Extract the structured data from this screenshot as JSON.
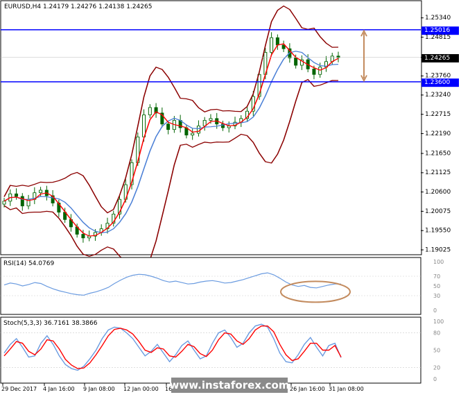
{
  "header": {
    "symbol_line": "EURUSD,H4  1.24179 1.24276 1.24138 1.24265"
  },
  "price_axis": {
    "ticks": [
      "1.25340",
      "1.24815",
      "1.24265",
      "1.23760",
      "1.23240",
      "1.22715",
      "1.22190",
      "1.21650",
      "1.21125",
      "1.20600",
      "1.20075",
      "1.19550",
      "1.19025"
    ],
    "tick_values": [
      1.2534,
      1.24815,
      1.24265,
      1.2376,
      1.2324,
      1.22715,
      1.2219,
      1.2165,
      1.21125,
      1.206,
      1.20075,
      1.1955,
      1.19025
    ],
    "ylim": [
      1.1893,
      1.2562
    ]
  },
  "levels": {
    "resistance": {
      "label": "1.25016",
      "value": 1.25016,
      "color": "#0000ff"
    },
    "support": {
      "label": "1.23600",
      "value": 1.236,
      "color": "#0000ff"
    },
    "current": {
      "label": "1.24265",
      "value": 1.24265,
      "color": "#000000"
    }
  },
  "rsi_panel": {
    "label": "RSI(14) 54.0769",
    "ticks": [
      "100",
      "70",
      "50",
      "30",
      "0"
    ],
    "tick_values": [
      100,
      70,
      50,
      30,
      0
    ]
  },
  "stoch_panel": {
    "label": "Stoch(5,3,3) 36.7161 38.3866",
    "ticks": [
      "100",
      "80",
      "50",
      "20",
      "0"
    ],
    "tick_values": [
      100,
      80,
      50,
      20,
      0
    ]
  },
  "time_axis": {
    "labels": [
      "29 Dec 2017",
      "4 Jan 16:00",
      "9 Jan 08:00",
      "12 Jan 00:00",
      "16 Jan",
      "26 Jan 16:00",
      "31 Jan 08:00"
    ]
  },
  "watermark": "www.instaforex.com",
  "colors": {
    "candle": "#006400",
    "bollinger": "#8b0000",
    "ma_fast": "#ff0000",
    "ma_slow": "#4a7fd6",
    "rsi_line": "#6a9be0",
    "stoch_main": "#6a9be0",
    "stoch_signal": "#ff0000",
    "annotation": "#c38b5e"
  },
  "chart_data": [
    {
      "type": "candlestick",
      "title": "EURUSD,H4",
      "approx_closes": [
        1.2035,
        1.2055,
        1.2048,
        1.2022,
        1.204,
        1.2058,
        1.2065,
        1.205,
        1.203,
        1.2005,
        1.1985,
        1.1965,
        1.1945,
        1.1935,
        1.194,
        1.195,
        1.196,
        1.1975,
        1.2,
        1.204,
        1.208,
        1.214,
        1.221,
        1.227,
        1.229,
        1.2275,
        1.2245,
        1.223,
        1.2255,
        1.2235,
        1.2215,
        1.222,
        1.224,
        1.2255,
        1.226,
        1.2245,
        1.2235,
        1.224,
        1.225,
        1.226,
        1.228,
        1.232,
        1.238,
        1.244,
        1.248,
        1.246,
        1.245,
        1.2425,
        1.2405,
        1.242,
        1.2395,
        1.238,
        1.24,
        1.2415,
        1.243,
        1.2426
      ]
    },
    {
      "type": "line",
      "title": "RSI(14) 54.0769",
      "ylim": [
        0,
        100
      ],
      "values": [
        52,
        56,
        54,
        50,
        53,
        57,
        55,
        49,
        44,
        40,
        37,
        34,
        32,
        31,
        35,
        38,
        42,
        47,
        55,
        62,
        68,
        72,
        74,
        73,
        70,
        66,
        61,
        58,
        60,
        57,
        54,
        55,
        58,
        60,
        61,
        59,
        56,
        57,
        60,
        63,
        67,
        71,
        75,
        77,
        73,
        66,
        58,
        52,
        49,
        51,
        47,
        46,
        49,
        52,
        54,
        54
      ]
    },
    {
      "type": "line",
      "title": "Stoch(5,3,3) 36.7161 38.3866",
      "ylim": [
        0,
        100
      ],
      "series": [
        {
          "values": [
            45,
            60,
            70,
            55,
            38,
            40,
            62,
            75,
            60,
            40,
            25,
            18,
            15,
            22,
            35,
            50,
            70,
            85,
            90,
            88,
            80,
            70,
            55,
            40,
            48,
            60,
            45,
            30,
            42,
            58,
            66,
            50,
            35,
            40,
            62,
            80,
            85,
            72,
            55,
            62,
            80,
            92,
            95,
            90,
            70,
            45,
            30,
            28,
            42,
            60,
            72,
            55,
            40,
            58,
            62,
            37
          ]
        },
        {
          "values": [
            40,
            52,
            65,
            62,
            48,
            42,
            52,
            68,
            66,
            52,
            34,
            24,
            18,
            19,
            28,
            42,
            58,
            75,
            86,
            88,
            85,
            78,
            65,
            50,
            46,
            54,
            52,
            40,
            38,
            48,
            60,
            56,
            44,
            39,
            50,
            68,
            80,
            78,
            66,
            60,
            70,
            85,
            92,
            92,
            82,
            60,
            42,
            32,
            35,
            48,
            62,
            62,
            50,
            50,
            58,
            38
          ]
        }
      ]
    }
  ]
}
